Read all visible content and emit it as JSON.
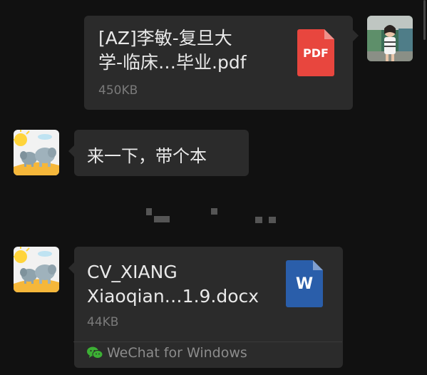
{
  "messages": [
    {
      "direction": "outgoing",
      "file_name_line1": "[AZ]李敏-复旦大",
      "file_name_line2": "学-临床…毕业.pdf",
      "file_size": "450KB",
      "icon": "pdf-icon",
      "icon_label": "PDF"
    },
    {
      "direction": "incoming",
      "text": "来一下，带个本"
    },
    {
      "direction": "incoming",
      "file_name_line1": "CV_XIANG",
      "file_name_line2": "Xiaoqian…1.9.docx",
      "file_size": "44KB",
      "icon": "word-icon",
      "icon_label": "W",
      "source": "WeChat for Windows"
    }
  ],
  "colors": {
    "background": "#111111",
    "bubble": "#2b2b2b",
    "pdf": "#e8463e",
    "word": "#2a5eaa",
    "wechat_green": "#3cb034"
  }
}
